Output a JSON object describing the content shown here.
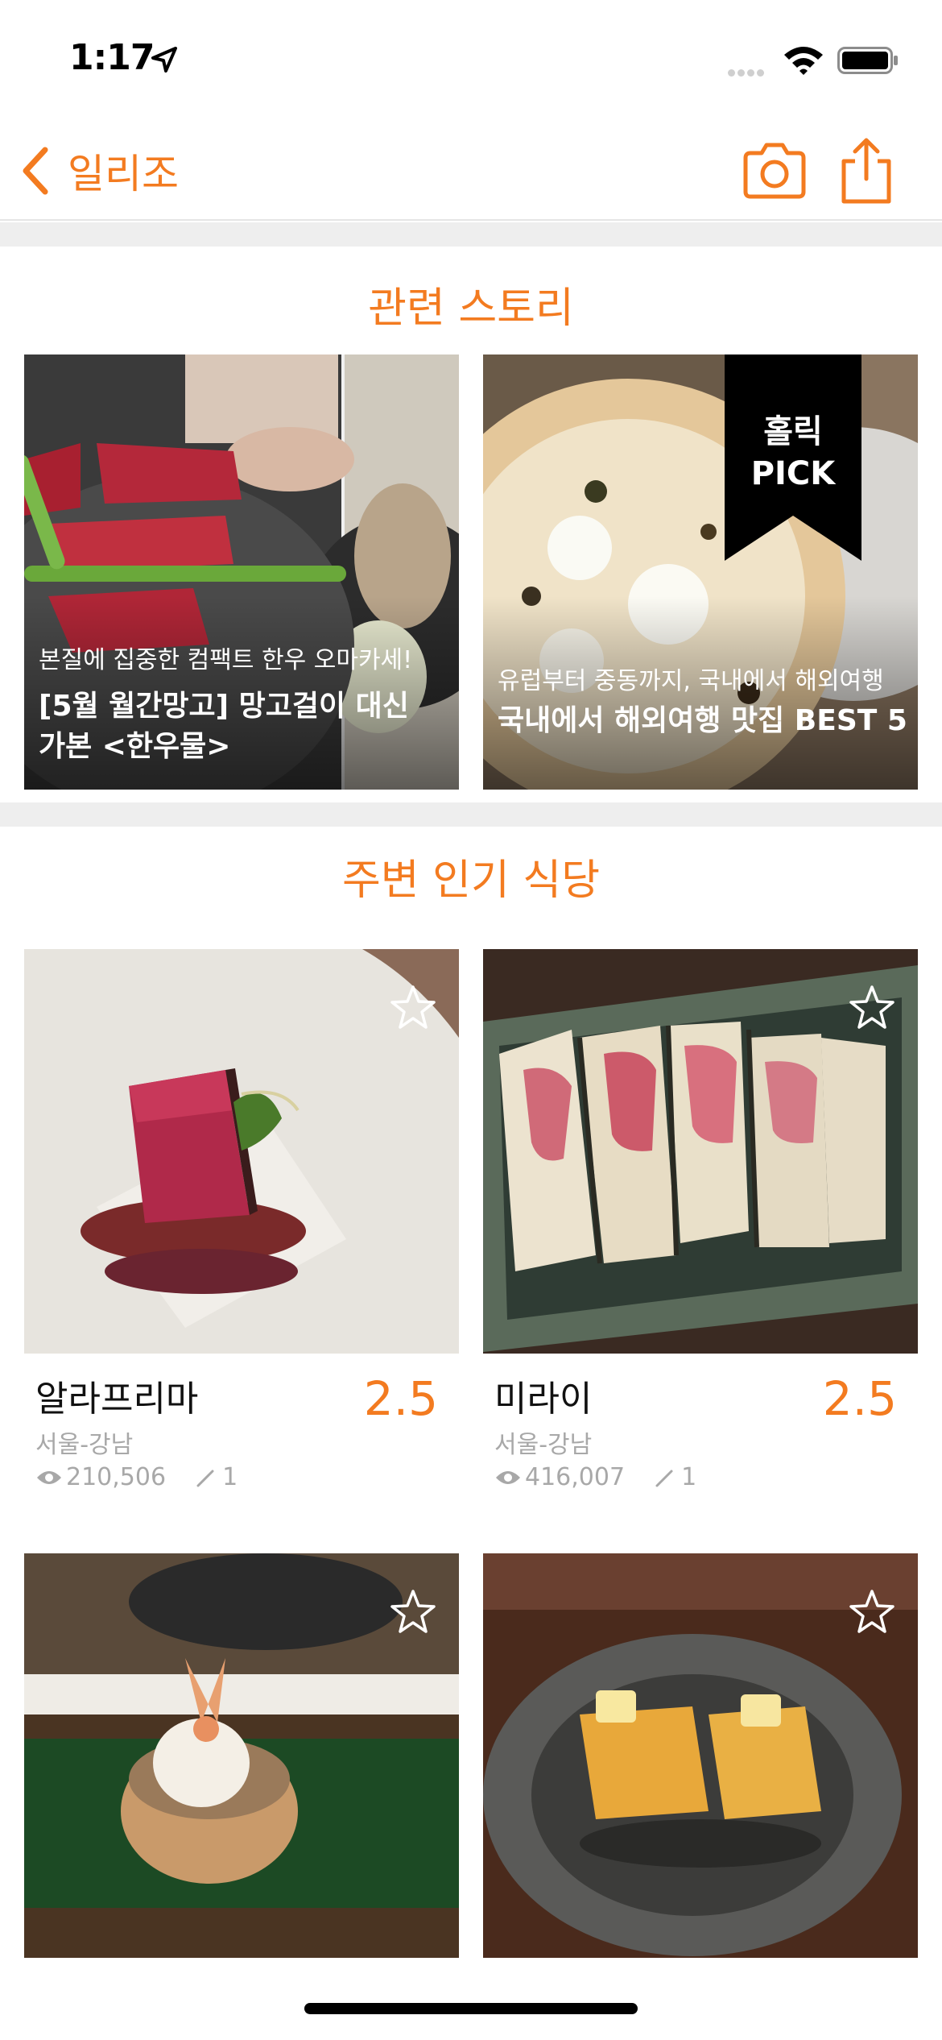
{
  "status_bar": {
    "time": "1:17"
  },
  "nav": {
    "back_label": "일리조"
  },
  "stories": {
    "section_title": "관련 스토리",
    "items": [
      {
        "subtitle": "본질에 집중한 컴팩트 한우 오마카세!",
        "title": "[5월 월간망고] 망고걸이 대신 가본 <한우물>"
      },
      {
        "subtitle": "유럽부터 중동까지, 국내에서 해외여행",
        "title": "국내에서 해외여행 맛집 BEST 5",
        "ribbon": "홀릭 PICK"
      }
    ]
  },
  "nearby": {
    "section_title": "주변 인기 식당",
    "items": [
      {
        "name": "알라프리마",
        "score": "2.5",
        "area": "서울-강남",
        "views": "210,506",
        "reviews": "1"
      },
      {
        "name": "미라이",
        "score": "2.5",
        "area": "서울-강남",
        "views": "416,007",
        "reviews": "1"
      },
      {
        "name": "",
        "score": "",
        "area": "",
        "views": "",
        "reviews": ""
      },
      {
        "name": "",
        "score": "",
        "area": "",
        "views": "",
        "reviews": ""
      }
    ]
  },
  "colors": {
    "accent": "#f37b20",
    "muted_text": "#a8a8a8",
    "divider": "#eeeeee"
  },
  "icons": [
    "location-arrow-icon",
    "wifi-icon",
    "battery-icon",
    "back-chevron-icon",
    "camera-icon",
    "share-icon",
    "star-outline-icon",
    "eye-icon",
    "pencil-icon"
  ]
}
